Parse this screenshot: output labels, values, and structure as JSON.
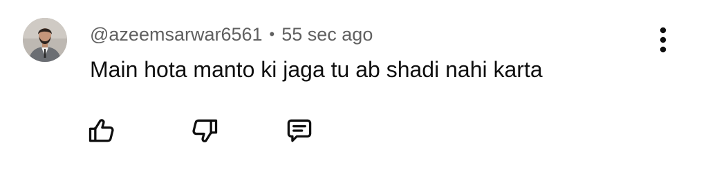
{
  "comment": {
    "author": "@azeemsarwar6561",
    "separator": "•",
    "time": "55 sec ago",
    "text": "Main hota manto ki jaga tu ab shadi nahi karta"
  },
  "icons": {
    "avatar": "user-avatar",
    "more": "vertical-ellipsis-icon",
    "like": "thumbs-up-icon",
    "dislike": "thumbs-down-icon",
    "reply": "comment-reply-icon"
  }
}
